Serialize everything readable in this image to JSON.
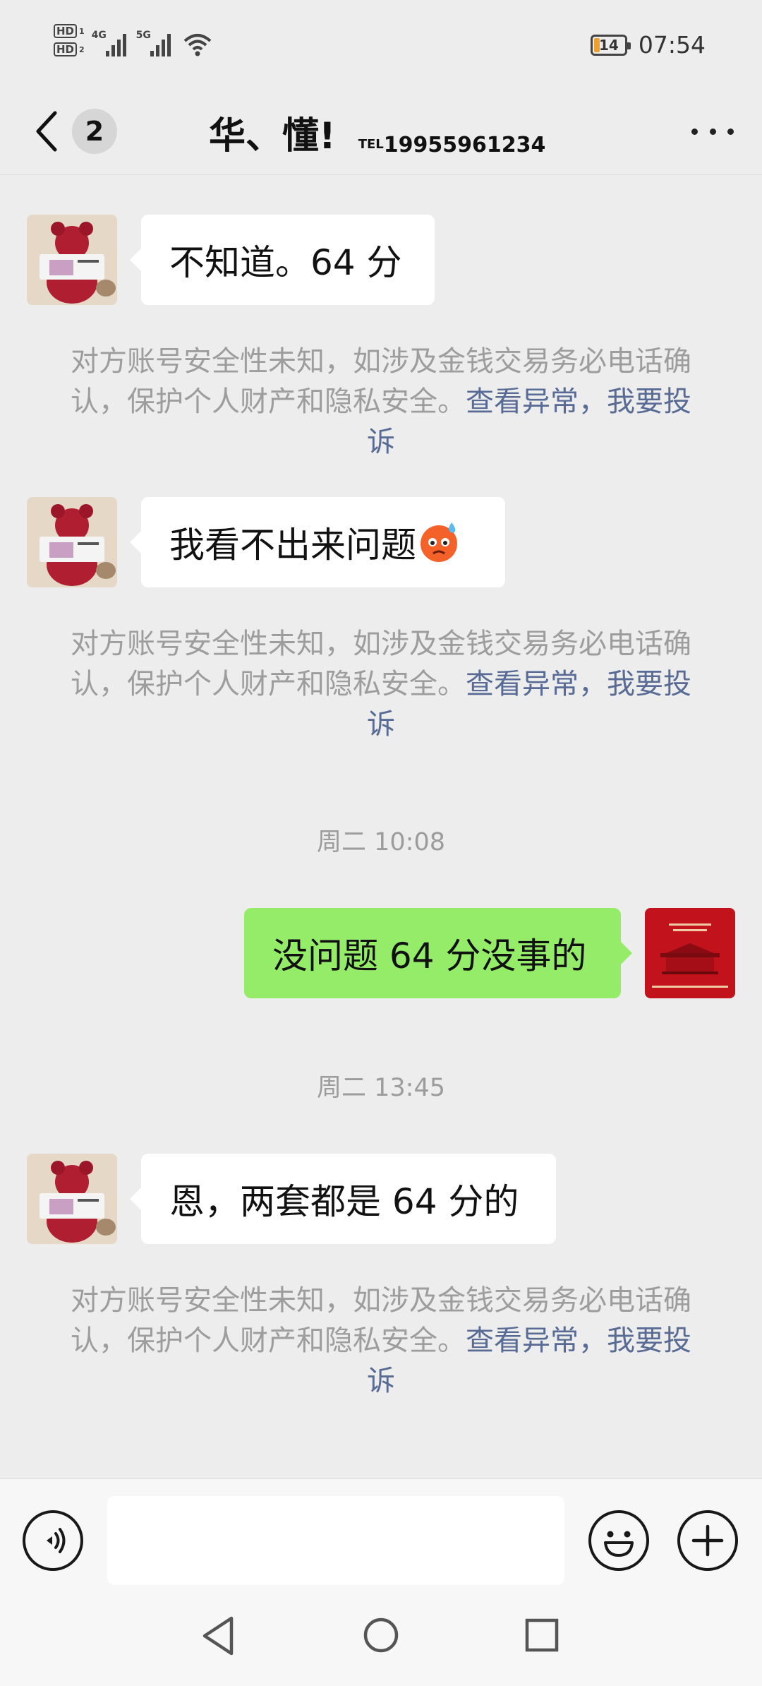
{
  "status_bar": {
    "sim1": "HD",
    "sim1_index": "1",
    "sim2": "HD",
    "sim2_index": "2",
    "network1": "4G",
    "network2": "5G",
    "battery_level": "14",
    "time": "07:54"
  },
  "header": {
    "unread_count": "2",
    "chat_name": "华、懂!",
    "tel_label": "TEL",
    "tel_number": "19955961234"
  },
  "messages": {
    "m1": {
      "text": "不知道。64 分"
    },
    "m2": {
      "text": "我看不出来问题"
    },
    "t1": "周二 10:08",
    "m3": {
      "text": "没问题 64 分没事的"
    },
    "t2": "周二 13:45",
    "m4": {
      "text": "恩，两套都是 64 分的"
    }
  },
  "security_notice": {
    "text": "对方账号安全性未知，如涉及金钱交易务必电话确认，保护个人财产和隐私安全。",
    "link_view": "查看异常",
    "separator": "，",
    "link_report": "我要投诉"
  },
  "icons": {
    "back": "chevron-left-icon",
    "more": "more-icon",
    "voice": "voice-icon",
    "emoji": "emoji-icon",
    "add": "plus-icon",
    "sweat_emoji": "sweat-emoji-icon"
  },
  "colors": {
    "background": "#ededed",
    "incoming_bubble": "#ffffff",
    "outgoing_bubble": "#95ec69",
    "link": "#576b95",
    "notice_text": "#9d9d9d"
  }
}
